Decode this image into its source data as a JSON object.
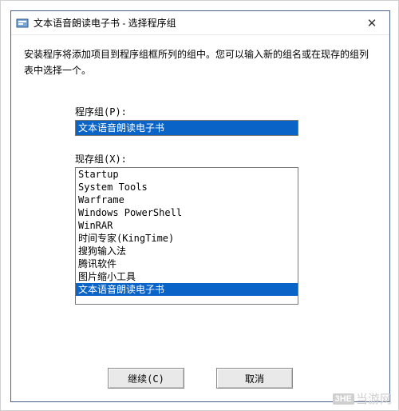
{
  "window": {
    "title": "文本语音朗读电子书 - 选择程序组",
    "description": "安装程序将添加项目到程序组框所列的组中。您可以输入新的组名或在现存的组列表中选择一个。"
  },
  "program_group": {
    "label": "程序组(P):",
    "value": "文本语音朗读电子书"
  },
  "existing_groups": {
    "label": "现存组(X):",
    "items": [
      "Startup",
      "System Tools",
      "Warframe",
      "Windows PowerShell",
      "WinRAR",
      "时间专家(KingTime)",
      "搜狗输入法",
      "腾讯软件",
      "图片缩小工具",
      "文本语音朗读电子书"
    ],
    "selected_index": 9
  },
  "buttons": {
    "continue": "继续(C)",
    "cancel": "取消"
  },
  "watermark": {
    "badge": "3HE",
    "text": "当游网"
  }
}
